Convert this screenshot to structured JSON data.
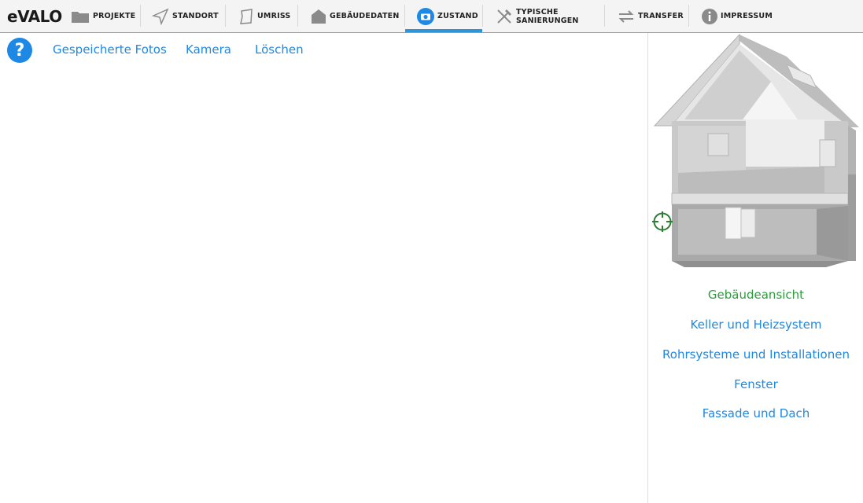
{
  "app": {
    "logo_main": "eVALO"
  },
  "nav": {
    "items": [
      {
        "label": "PROJEKTE",
        "icon": "folder-icon"
      },
      {
        "label": "STANDORT",
        "icon": "location-arrow-icon"
      },
      {
        "label": "UMRISS",
        "icon": "outline-shape-icon"
      },
      {
        "label": "GEBÄUDEDATEN",
        "icon": "house-icon"
      },
      {
        "label": "ZUSTAND",
        "icon": "camera-icon"
      },
      {
        "label_line1": "TYPISCHE",
        "label_line2": "SANIERUNGEN",
        "icon": "tools-icon"
      },
      {
        "label": "TRANSFER",
        "icon": "transfer-arrows-icon"
      },
      {
        "label": "IMPRESSUM",
        "icon": "info-icon"
      }
    ],
    "active_index": 4
  },
  "toolbar": {
    "help_glyph": "?",
    "saved_photos": "Gespeicherte Fotos",
    "camera": "Kamera",
    "delete": "Löschen"
  },
  "categories": {
    "items": [
      {
        "label": "Gebäudeansicht",
        "active": true
      },
      {
        "label": "Keller und Heizsystem",
        "active": false
      },
      {
        "label": "Rohrsysteme und Installationen",
        "active": false
      },
      {
        "label": "Fenster",
        "active": false
      },
      {
        "label": "Fassade und Dach",
        "active": false
      }
    ]
  },
  "colors": {
    "accent_blue": "#1e88e5",
    "active_green": "#2e9b3e",
    "nav_bar_bg": "#f4f4f4"
  }
}
